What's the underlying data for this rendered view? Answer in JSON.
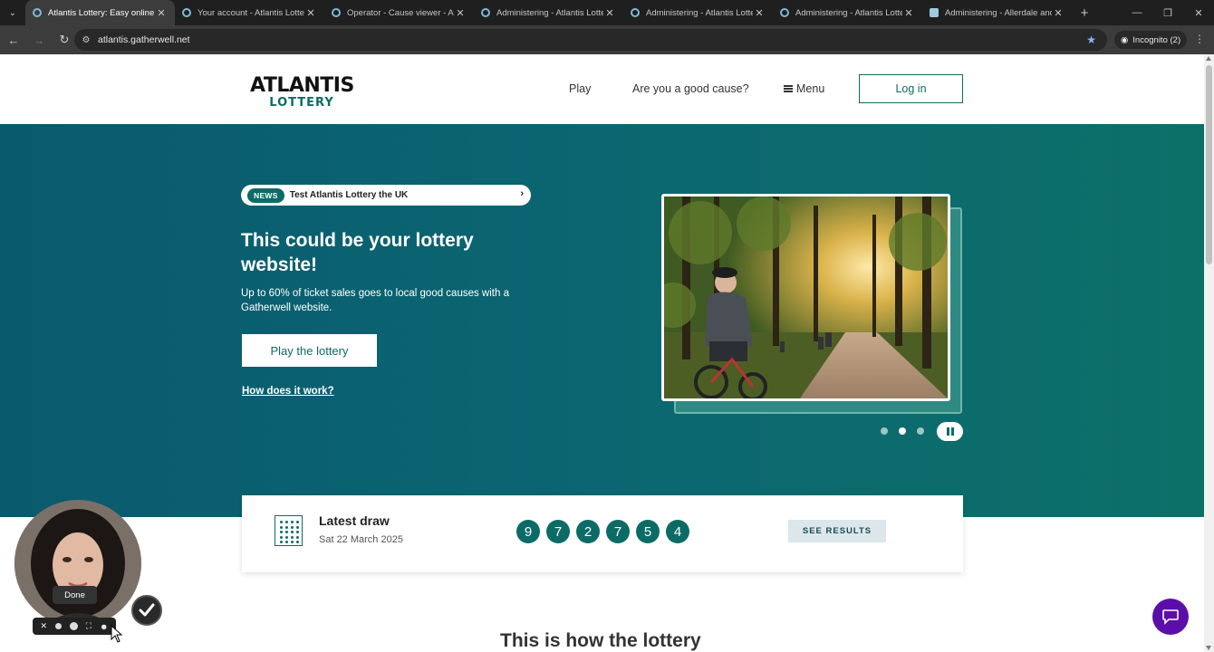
{
  "browser": {
    "tabs": [
      {
        "title": "Atlantis Lottery: Easy online fun",
        "active": true,
        "icon": "gatherwell-favicon"
      },
      {
        "title": "Your account - Atlantis Lottery",
        "active": false,
        "icon": "gatherwell-favicon"
      },
      {
        "title": "Operator - Cause viewer - Atlan",
        "active": false,
        "icon": "gatherwell-favicon"
      },
      {
        "title": "Administering - Atlantis Lottery",
        "active": false,
        "icon": "gatherwell-favicon"
      },
      {
        "title": "Administering - Atlantis Lottery",
        "active": false,
        "icon": "gatherwell-favicon"
      },
      {
        "title": "Administering - Atlantis Lottery",
        "active": false,
        "icon": "gatherwell-favicon"
      },
      {
        "title": "Administering - Allerdale and U",
        "active": false,
        "icon": "document-favicon"
      }
    ],
    "url": "atlantis.gatherwell.net",
    "incognito_label": "Incognito (2)"
  },
  "header": {
    "logo_top": "ATLANTIS",
    "logo_bottom": "LOTTERY",
    "nav": {
      "play": "Play",
      "good_cause": "Are you a good cause?",
      "menu": "Menu"
    },
    "login_label": "Log in"
  },
  "hero": {
    "news_badge": "NEWS",
    "news_text": "Test Atlantis Lottery  the UK",
    "title": "This could be your lottery website!",
    "subtitle": "Up to 60% of ticket sales goes to local good causes with a Gatherwell website.",
    "cta_label": "Play the lottery",
    "how_link": "How does it work?",
    "carousel": {
      "slides": 3,
      "active_slide": 2
    }
  },
  "draw": {
    "label": "Latest draw",
    "date": "Sat 22 March 2025",
    "numbers": [
      "9",
      "7",
      "2",
      "7",
      "5",
      "4"
    ],
    "results_label": "SEE RESULTS"
  },
  "section": {
    "title": "This is how the lottery"
  },
  "overlay": {
    "done_label": "Done"
  },
  "colors": {
    "brand_teal": "#0d6b66",
    "hero_bg": "#0b6671",
    "chat_purple": "#5b0fa8",
    "results_btn_bg": "#dbe7ea"
  }
}
